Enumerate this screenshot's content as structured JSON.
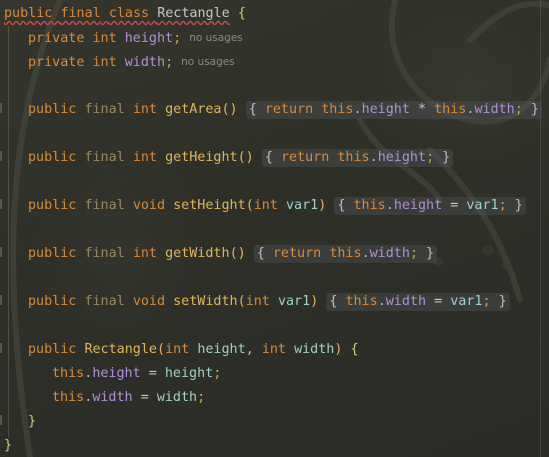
{
  "editor": {
    "language": "java",
    "hints": {
      "field_height": "no usages",
      "field_width": "no usages"
    },
    "tokens": {
      "public": "public",
      "final": "final",
      "class": "class",
      "private": "private",
      "int": "int",
      "void": "void",
      "return": "return",
      "this": "this",
      "class_name": "Rectangle",
      "height": "height",
      "width": "width",
      "getArea": "getArea",
      "getHeight": "getHeight",
      "setHeight": "setHeight",
      "getWidth": "getWidth",
      "setWidth": "setWidth",
      "var1": "var1"
    }
  }
}
